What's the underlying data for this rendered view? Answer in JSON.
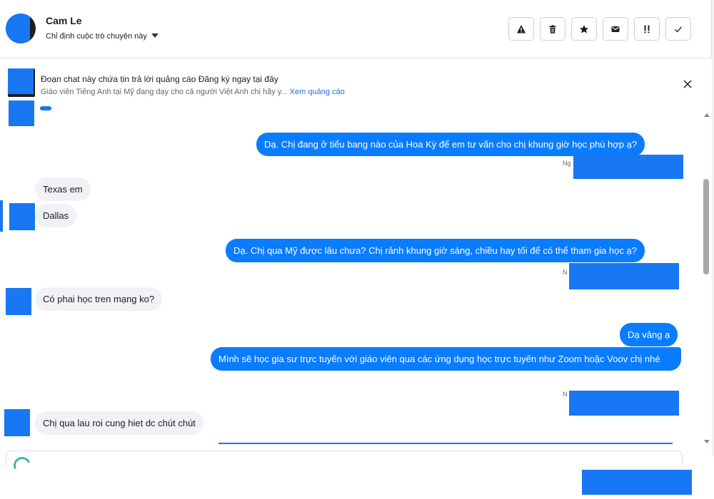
{
  "header": {
    "contact_name": "Cam Le",
    "assign_label": "Chỉ định cuộc trò chuyện này",
    "actions": [
      {
        "name": "report-spam-button",
        "icon": "warning-icon"
      },
      {
        "name": "delete-button",
        "icon": "trash-icon"
      },
      {
        "name": "star-button",
        "icon": "star-icon"
      },
      {
        "name": "mark-unread-button",
        "icon": "envelope-icon"
      },
      {
        "name": "follow-up-button",
        "icon": "exclamation-icon"
      },
      {
        "name": "mark-done-button",
        "icon": "check-icon"
      }
    ]
  },
  "banner": {
    "title": "Đoạn chat này chứa tin trả lời quảng cáo Đăng ký ngay tại đây",
    "subtitle": "Giáo viên Tiếng Anh tại Mỹ đang dạy cho cả người Việt Anh chị hãy y...",
    "link": "Xem quảng cáo"
  },
  "messages": [
    {
      "dir": "out",
      "text": "Dạ. Chị đang ở tiểu bang nào của Hoa Kỳ để em tư vấn cho chị khung giờ học phù hợp ạ?"
    },
    {
      "dir": "meta",
      "text": "Ng"
    },
    {
      "dir": "in",
      "text": "Texas em"
    },
    {
      "dir": "in",
      "text": "Dallas"
    },
    {
      "dir": "out",
      "text": "Dạ. Chị qua Mỹ được lâu chưa? Chị rảnh khung giờ sáng, chiều hay tối để có thể tham gia học ạ?"
    },
    {
      "dir": "meta",
      "text": "N"
    },
    {
      "dir": "in",
      "text": "Có phai học tren mạng ko?"
    },
    {
      "dir": "out",
      "text": "Dạ vâng ạ"
    },
    {
      "dir": "out",
      "text": "Mình sẽ học gia sư trực tuyến với giáo viên qua các ứng dụng học trực tuyến như Zoom hoặc Voov chị nhé"
    },
    {
      "dir": "meta",
      "text": "N"
    },
    {
      "dir": "in",
      "text": "Chị qua lau roi cung hiet dc chút chút"
    }
  ],
  "colors": {
    "outgoing_bubble": "#0a7cff",
    "incoming_bubble": "#f0f2f5",
    "redaction": "#1877f2",
    "link": "#216fdb"
  }
}
